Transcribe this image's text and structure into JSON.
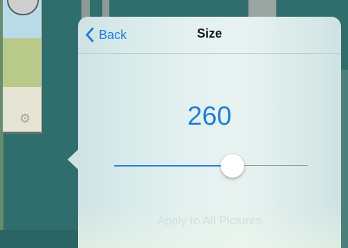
{
  "popover": {
    "back_label": "Back",
    "title": "Size",
    "size_value": "260",
    "apply_label": "Apply to All Pictures"
  },
  "slider": {
    "fraction": 0.61
  },
  "icons": {
    "back": "chevron-left-icon",
    "settings": "gear-icon"
  },
  "colors": {
    "accent": "#1f7ed8",
    "background": "#2f6e6d",
    "disabled_text": "#c9dad9"
  }
}
